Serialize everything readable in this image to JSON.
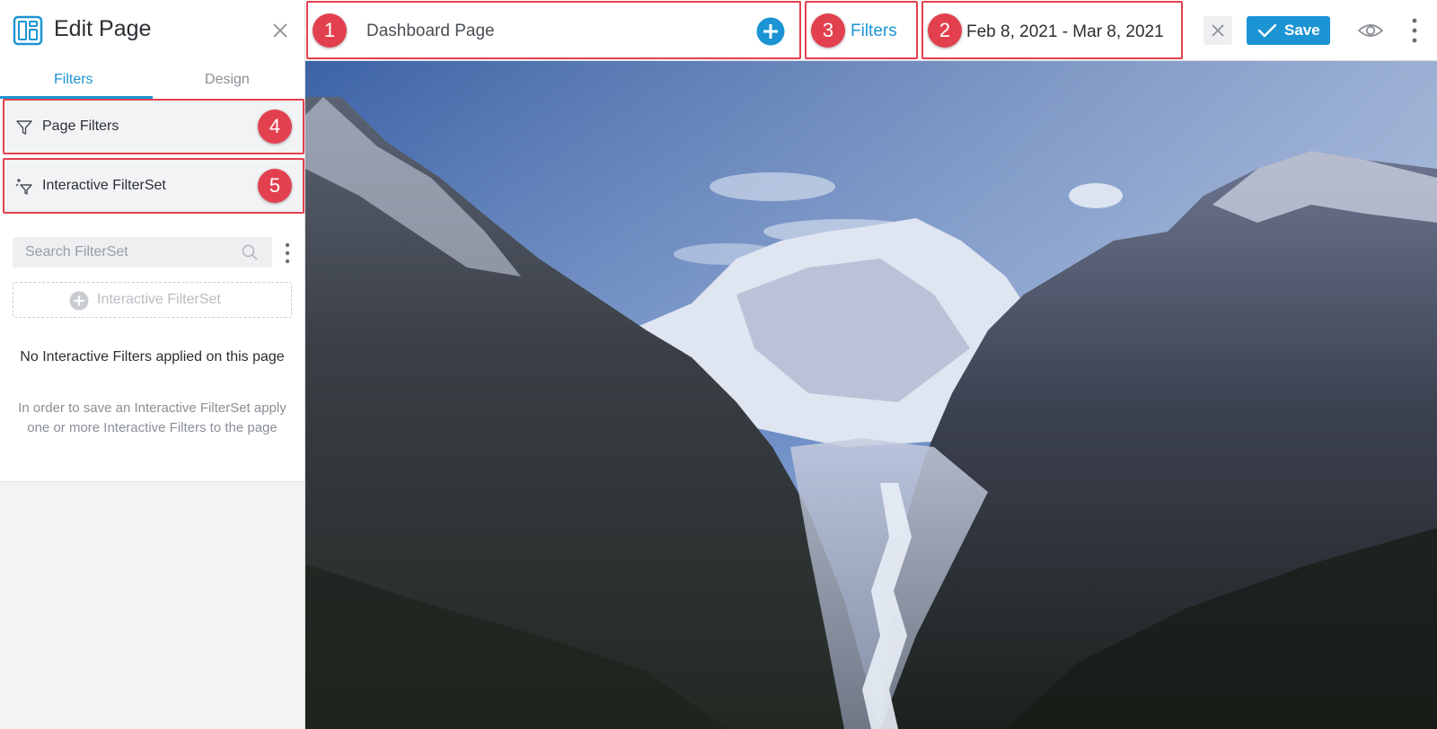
{
  "sidebar": {
    "title": "Edit Page",
    "tabs": [
      {
        "label": "Filters",
        "active": true
      },
      {
        "label": "Design",
        "active": false
      }
    ],
    "sections": [
      {
        "label": "Page Filters",
        "badge": "4",
        "icon": "filter-icon"
      },
      {
        "label": "Interactive FilterSet",
        "badge": "5",
        "icon": "interactive-filter-icon"
      }
    ],
    "search": {
      "placeholder": "Search FilterSet",
      "value": ""
    },
    "add_button_label": "Interactive FilterSet",
    "empty_title": "No Interactive Filters applied on this page",
    "empty_body": "In order to save an Interactive FilterSet apply one or more Interactive Filters to the page"
  },
  "toolbar": {
    "page_name": "Dashboard Page",
    "page_badge": "1",
    "filters_label": "Filters",
    "filters_badge": "3",
    "date_range": "Feb 8, 2021 - Mar 8, 2021",
    "date_badge": "2",
    "save_label": "Save"
  },
  "colors": {
    "accent": "#1c94d4",
    "highlight": "#e3404f",
    "sidebar_bg": "#f2f3f5"
  },
  "canvas": {
    "image": "mountain-valley-landscape-photo"
  }
}
